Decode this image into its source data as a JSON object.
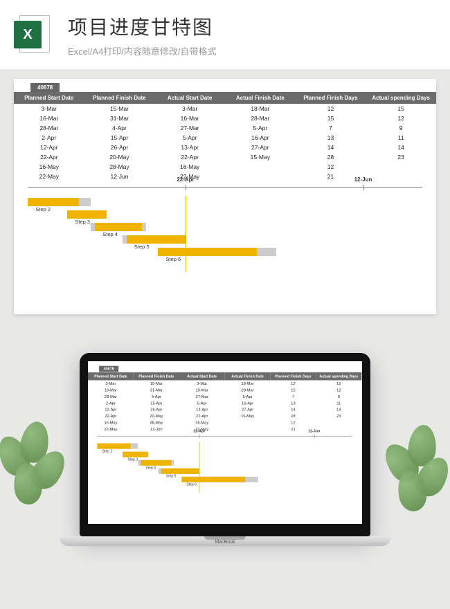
{
  "header": {
    "icon_letter": "X",
    "title": "项目进度甘特图",
    "subtitle": "Excel/A4打印/内容随意修改/自带格式"
  },
  "sheet": {
    "corner_value": "40678",
    "columns": [
      "Planned Start Date",
      "Planned Finish Date",
      "Actual Start Date",
      "Actual Finish Date",
      "Planned Finish Days",
      "Actual spending Days"
    ],
    "rows": [
      {
        "psd": "3-Mar",
        "pfd": "15-Mar",
        "asd": "3-Mar",
        "afd": "18-Mar",
        "pfdays": "12",
        "asdays": "15"
      },
      {
        "psd": "16-Mar",
        "pfd": "31-Mar",
        "asd": "16-Mar",
        "afd": "28-Mar",
        "pfdays": "15",
        "asdays": "12"
      },
      {
        "psd": "28-Mar",
        "pfd": "4-Apr",
        "asd": "27-Mar",
        "afd": "5-Apr",
        "pfdays": "7",
        "asdays": "9"
      },
      {
        "psd": "2-Apr",
        "pfd": "15-Apr",
        "asd": "5-Apr",
        "afd": "16-Apr",
        "pfdays": "13",
        "asdays": "11"
      },
      {
        "psd": "12-Apr",
        "pfd": "26-Apr",
        "asd": "13-Apr",
        "afd": "27-Apr",
        "pfdays": "14",
        "asdays": "14"
      },
      {
        "psd": "22-Apr",
        "pfd": "20-May",
        "asd": "22-Apr",
        "afd": "15-May",
        "pfdays": "28",
        "asdays": "23"
      },
      {
        "psd": "16-May",
        "pfd": "28-May",
        "asd": "16-May",
        "afd": "",
        "pfdays": "12",
        "asdays": ""
      },
      {
        "psd": "22-May",
        "pfd": "12-Jun",
        "asd": "22-May",
        "afd": "",
        "pfdays": "21",
        "asdays": ""
      }
    ]
  },
  "chart_data": {
    "type": "bar",
    "orientation": "horizontal-gantt",
    "timeline_labels": [
      {
        "label": "22-Apr",
        "pos_pct": 40
      },
      {
        "label": "12-Jun",
        "pos_pct": 85
      }
    ],
    "marker_pct": 40,
    "steps": [
      {
        "name": "Step 2",
        "planned_start_pct": 0,
        "planned_len_pct": 16,
        "actual_start_pct": 0,
        "actual_len_pct": 13
      },
      {
        "name": "Step 3",
        "planned_start_pct": 10,
        "planned_len_pct": 8,
        "actual_start_pct": 10,
        "actual_len_pct": 10
      },
      {
        "name": "Step 4",
        "planned_start_pct": 16,
        "planned_len_pct": 14,
        "actual_start_pct": 17,
        "actual_len_pct": 12
      },
      {
        "name": "Step 5",
        "planned_start_pct": 24,
        "planned_len_pct": 15,
        "actual_start_pct": 25,
        "actual_len_pct": 15
      },
      {
        "name": "Step 6",
        "planned_start_pct": 33,
        "planned_len_pct": 30,
        "actual_start_pct": 33,
        "actual_len_pct": 25
      }
    ]
  },
  "mockup": {
    "brand": "MacBook"
  }
}
